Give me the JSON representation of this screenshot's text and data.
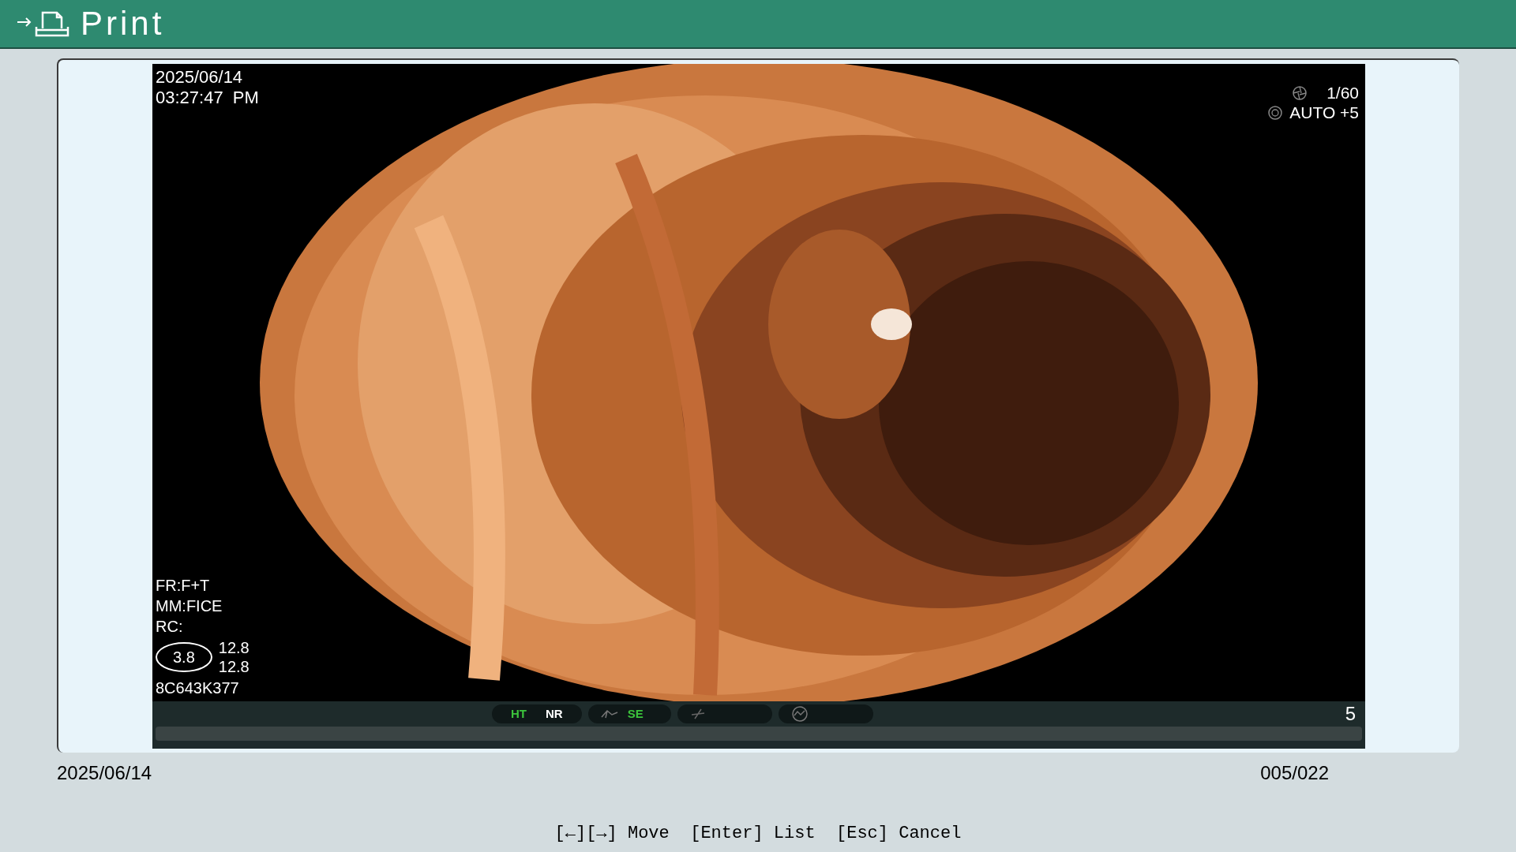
{
  "header": {
    "title": "Print"
  },
  "image": {
    "date": "2025/06/14",
    "time": "03:27:47  PM",
    "shutter": "1/60",
    "iris": "AUTO +5",
    "left_info": [
      "FR:F+T",
      "MM:FICE",
      "RC:"
    ],
    "zoom_value": "3.8",
    "readings": [
      "12.8",
      "12.8"
    ],
    "serial": "8C643K377",
    "status": [
      {
        "kind": "text",
        "label": "HT",
        "on": true
      },
      {
        "kind": "text",
        "label": "NR",
        "on": false
      },
      {
        "kind": "icon",
        "label": "SE",
        "on": true
      },
      {
        "kind": "icon-only"
      },
      {
        "kind": "gauge"
      }
    ],
    "frame_number": "5"
  },
  "footer": {
    "date": "2025/06/14",
    "counter": "005/022",
    "help": "[←][→] Move  [Enter] List  [Esc] Cancel"
  }
}
